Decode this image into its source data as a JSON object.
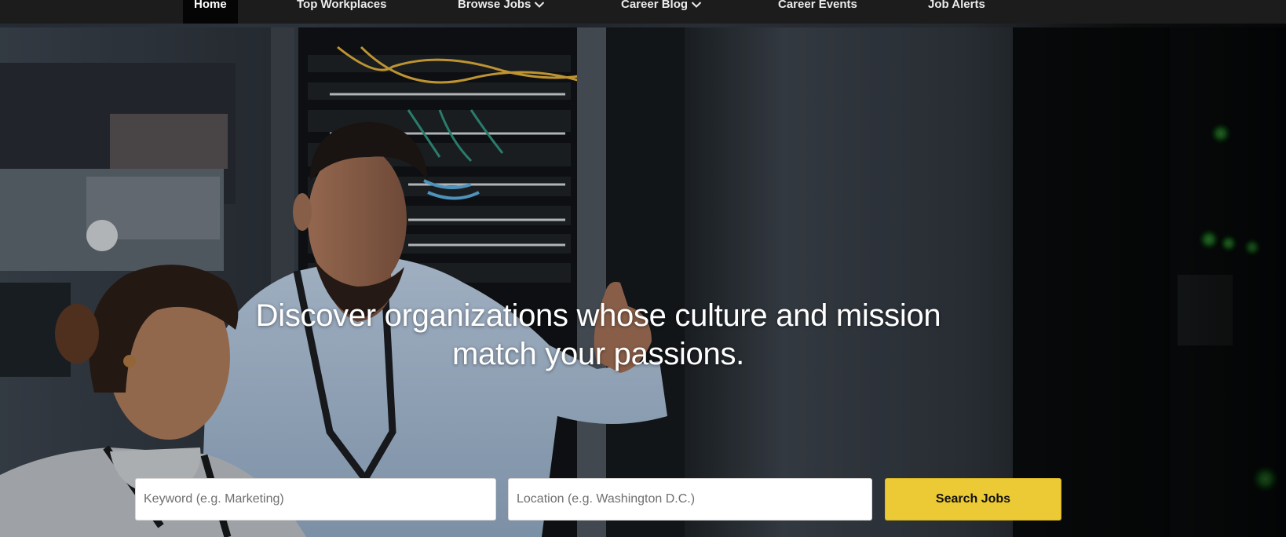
{
  "nav": {
    "items": [
      {
        "label": "Home",
        "active": true
      },
      {
        "label": "Top Workplaces",
        "active": false
      },
      {
        "label": "Browse Jobs",
        "active": false,
        "has_dropdown": true
      },
      {
        "label": "Career Blog",
        "active": false,
        "has_dropdown": true
      },
      {
        "label": "Career Events",
        "active": false
      },
      {
        "label": "Job Alerts",
        "active": false
      }
    ]
  },
  "hero": {
    "headline_line1": "Discover organizations whose culture and mission",
    "headline_line2": "match your passions."
  },
  "search": {
    "keyword_placeholder": "Keyword (e.g. Marketing)",
    "location_placeholder": "Location (e.g. Washington D.C.)",
    "button_label": "Search Jobs"
  },
  "colors": {
    "nav_bg": "#1c1c1c",
    "nav_active_bg": "#050505",
    "accent_yellow": "#ecca35"
  }
}
